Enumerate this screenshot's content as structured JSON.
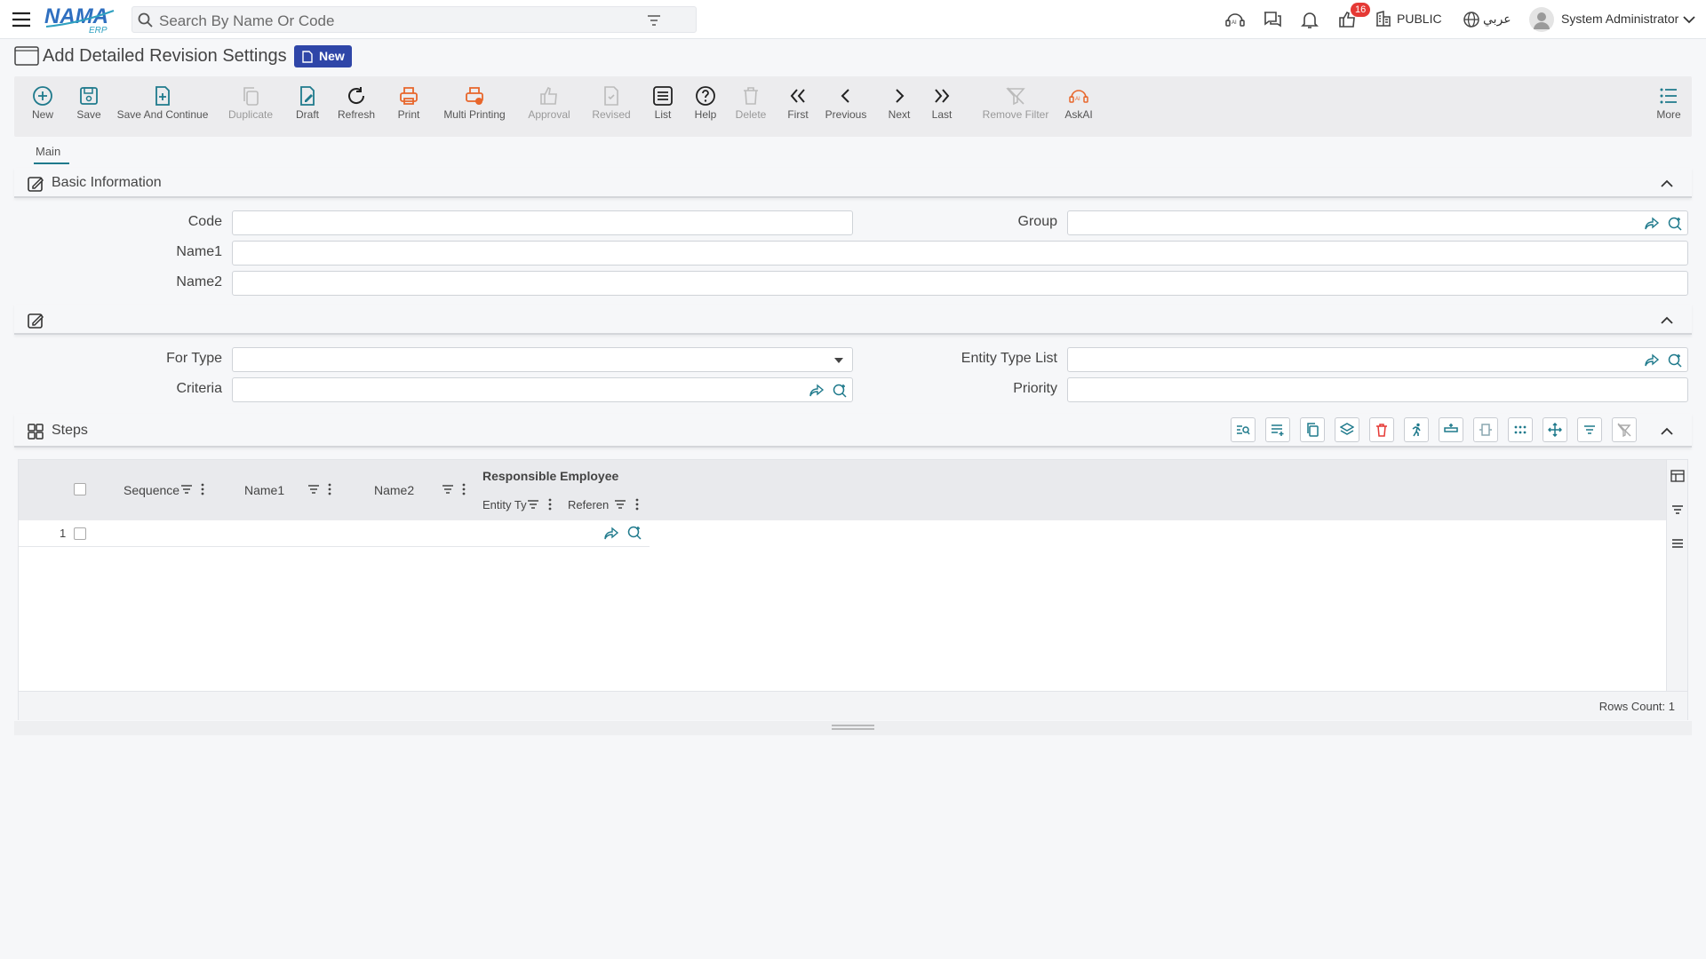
{
  "app": {
    "logo_text": "NAMA",
    "logo_sub": "ERP"
  },
  "search": {
    "placeholder": "Search By Name Or Code"
  },
  "topbar": {
    "notification_count": "16",
    "branch": "PUBLIC",
    "language": "عربي",
    "user": "System Administrator"
  },
  "page": {
    "title": "Add Detailed Revision Settings",
    "status_badge": "New"
  },
  "toolbar": {
    "new": "New",
    "save": "Save",
    "save_continue": "Save And Continue",
    "duplicate": "Duplicate",
    "draft": "Draft",
    "refresh": "Refresh",
    "print": "Print",
    "multi_printing": "Multi Printing",
    "approval": "Approval",
    "revised": "Revised",
    "list": "List",
    "help": "Help",
    "delete": "Delete",
    "first": "First",
    "previous": "Previous",
    "next": "Next",
    "last": "Last",
    "remove_filter": "Remove Filter",
    "askai": "AskAI",
    "more": "More"
  },
  "tabs": {
    "main": "Main"
  },
  "basic_info": {
    "title": "Basic Information",
    "code_label": "Code",
    "group_label": "Group",
    "name1_label": "Name1",
    "name2_label": "Name2"
  },
  "section2": {
    "for_type_label": "For Type",
    "entity_type_list_label": "Entity Type List",
    "criteria_label": "Criteria",
    "priority_label": "Priority"
  },
  "steps": {
    "title": "Steps",
    "columns": {
      "sequence": "Sequence",
      "name1": "Name1",
      "name2": "Name2",
      "responsible_employee": "Responsible Employee",
      "entity_type": "Entity Ty",
      "reference": "Referen"
    },
    "rows": [
      {
        "num": "1"
      }
    ],
    "rows_count": "Rows Count: 1"
  },
  "colors": {
    "accent": "#1f7a8c",
    "brand": "#2f46a8",
    "print": "#e8662b",
    "delete": "#e53935"
  }
}
